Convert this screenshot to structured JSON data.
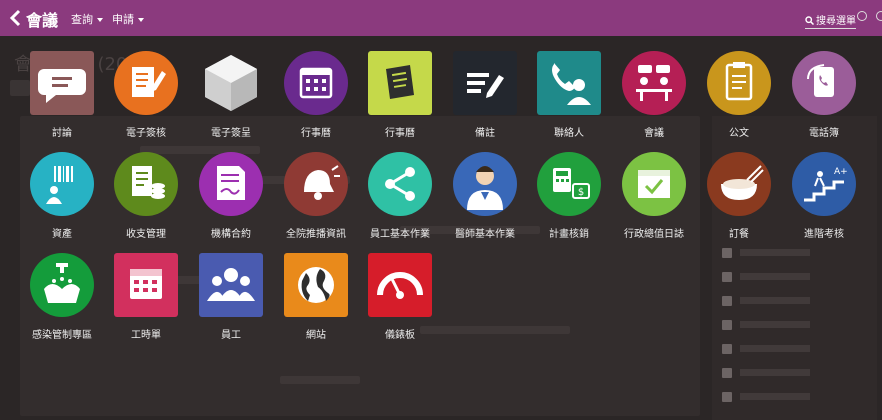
{
  "header": {
    "title": "會議",
    "menu_query": "查詢",
    "menu_apply": "申請",
    "search_label": "搜尋選單"
  },
  "background": {
    "title": "會議 六月 (20)"
  },
  "colors": {
    "topbar": "#8b3a7e",
    "overlay": "#2b2626"
  },
  "apps": [
    {
      "label": "討論",
      "icon": "chat-bubble-icon",
      "color": "#8a5858"
    },
    {
      "label": "電子簽核",
      "icon": "document-edit-icon",
      "color": "#e8711f"
    },
    {
      "label": "電子簽呈",
      "icon": "cube-icon",
      "color": "#e6e6e6"
    },
    {
      "label": "行事曆",
      "icon": "calendar-icon",
      "color": "#6a2a8e"
    },
    {
      "label": "行事曆",
      "icon": "notebook-icon",
      "color": "#c5d94a"
    },
    {
      "label": "備註",
      "icon": "notes-pen-icon",
      "color": "#23272e"
    },
    {
      "label": "聯絡人",
      "icon": "contact-phone-icon",
      "color": "#1f8a8a"
    },
    {
      "label": "會議",
      "icon": "meeting-icon",
      "color": "#b51f55"
    },
    {
      "label": "公文",
      "icon": "clipboard-icon",
      "color": "#c9961c"
    },
    {
      "label": "電話簿",
      "icon": "phonebook-icon",
      "color": "#9b5d99"
    },
    {
      "label": "資產",
      "icon": "barcode-person-icon",
      "color": "#27b2c4"
    },
    {
      "label": "收支管理",
      "icon": "receipt-coins-icon",
      "color": "#5e8a1c"
    },
    {
      "label": "機構合約",
      "icon": "contract-icon",
      "color": "#9c2fb0"
    },
    {
      "label": "全院推播資訊",
      "icon": "bell-megaphone-icon",
      "color": "#8f3a34"
    },
    {
      "label": "員工基本作業",
      "icon": "share-icon",
      "color": "#2fc1a5"
    },
    {
      "label": "醫師基本作業",
      "icon": "doctor-icon",
      "color": "#3968b8"
    },
    {
      "label": "計畫核銷",
      "icon": "calculator-money-icon",
      "color": "#21a03d"
    },
    {
      "label": "行政總值日誌",
      "icon": "calendar-check-icon",
      "color": "#7cc243"
    },
    {
      "label": "訂餐",
      "icon": "rice-bowl-icon",
      "color": "#8a3a1f"
    },
    {
      "label": "進階考核",
      "icon": "stairs-climb-icon",
      "color": "#2e5ca6"
    },
    {
      "label": "感染管制專區",
      "icon": "handwash-icon",
      "color": "#149c3b"
    },
    {
      "label": "工時單",
      "icon": "calendar-grid-icon",
      "color": "#d2305e"
    },
    {
      "label": "員工",
      "icon": "people-group-icon",
      "color": "#4a5bb0"
    },
    {
      "label": "網站",
      "icon": "globe-icon",
      "color": "#e98a1b"
    },
    {
      "label": "儀錶板",
      "icon": "gauge-icon",
      "color": "#d61d2a"
    }
  ]
}
